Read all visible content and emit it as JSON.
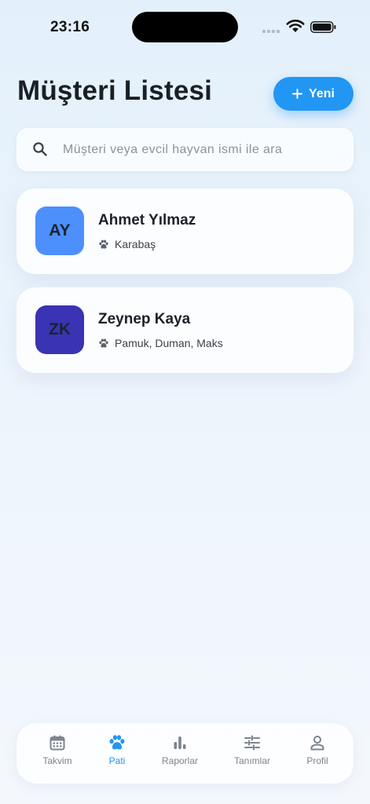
{
  "status_bar": {
    "time": "23:16"
  },
  "header": {
    "title": "Müşteri Listesi",
    "new_button_label": "Yeni"
  },
  "search": {
    "placeholder": "Müşteri veya evcil hayvan ismi ile ara",
    "value": ""
  },
  "customers": [
    {
      "initials": "AY",
      "name": "Ahmet Yılmaz",
      "pets": "Karabaş",
      "avatar_color": "#4d8ffd"
    },
    {
      "initials": "ZK",
      "name": "Zeynep Kaya",
      "pets": "Pamuk, Duman, Maks",
      "avatar_color": "#3a33b3"
    }
  ],
  "nav": {
    "items": [
      {
        "label": "Takvim",
        "icon": "calendar-icon",
        "active": false
      },
      {
        "label": "Pati",
        "icon": "paw-icon",
        "active": true
      },
      {
        "label": "Raporlar",
        "icon": "bar-chart-icon",
        "active": false
      },
      {
        "label": "Tanımlar",
        "icon": "sliders-icon",
        "active": false
      },
      {
        "label": "Profil",
        "icon": "user-icon",
        "active": false
      }
    ]
  },
  "colors": {
    "accent": "#2196f3",
    "inactive": "#7c848d"
  }
}
